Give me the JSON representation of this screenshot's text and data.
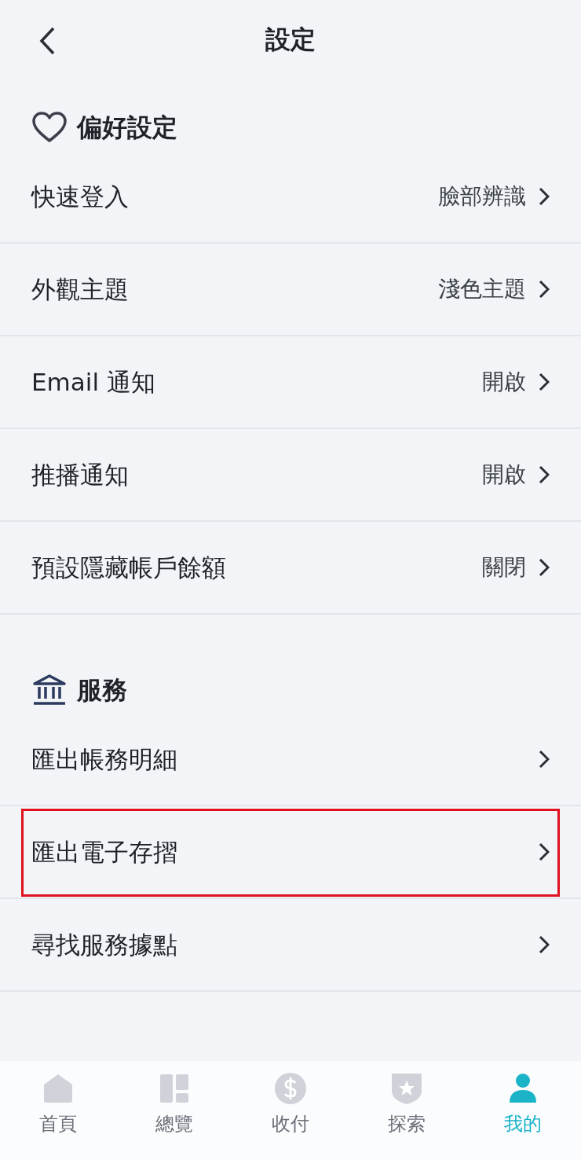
{
  "header": {
    "title": "設定"
  },
  "sections": [
    {
      "kind": "heart",
      "title": "偏好設定",
      "rows": [
        {
          "label": "快速登入",
          "value": "臉部辨識",
          "highlighted": false
        },
        {
          "label": "外觀主題",
          "value": "淺色主題",
          "highlighted": false
        },
        {
          "label": "Email 通知",
          "value": "開啟",
          "highlighted": false
        },
        {
          "label": "推播通知",
          "value": "開啟",
          "highlighted": false
        },
        {
          "label": "預設隱藏帳戶餘額",
          "value": "關閉",
          "highlighted": false
        }
      ]
    },
    {
      "kind": "bank",
      "title": "服務",
      "rows": [
        {
          "label": "匯出帳務明細",
          "highlighted": false
        },
        {
          "label": "匯出電子存摺",
          "highlighted": true
        },
        {
          "label": "尋找服務據點",
          "highlighted": false
        }
      ]
    }
  ],
  "nav": [
    {
      "kind": "home",
      "label": "首頁",
      "selected": false
    },
    {
      "kind": "overview",
      "label": "總覽",
      "selected": false
    },
    {
      "kind": "pay",
      "label": "收付",
      "selected": false
    },
    {
      "kind": "explore",
      "label": "探索",
      "selected": false
    },
    {
      "kind": "me",
      "label": "我的",
      "selected": true
    }
  ]
}
